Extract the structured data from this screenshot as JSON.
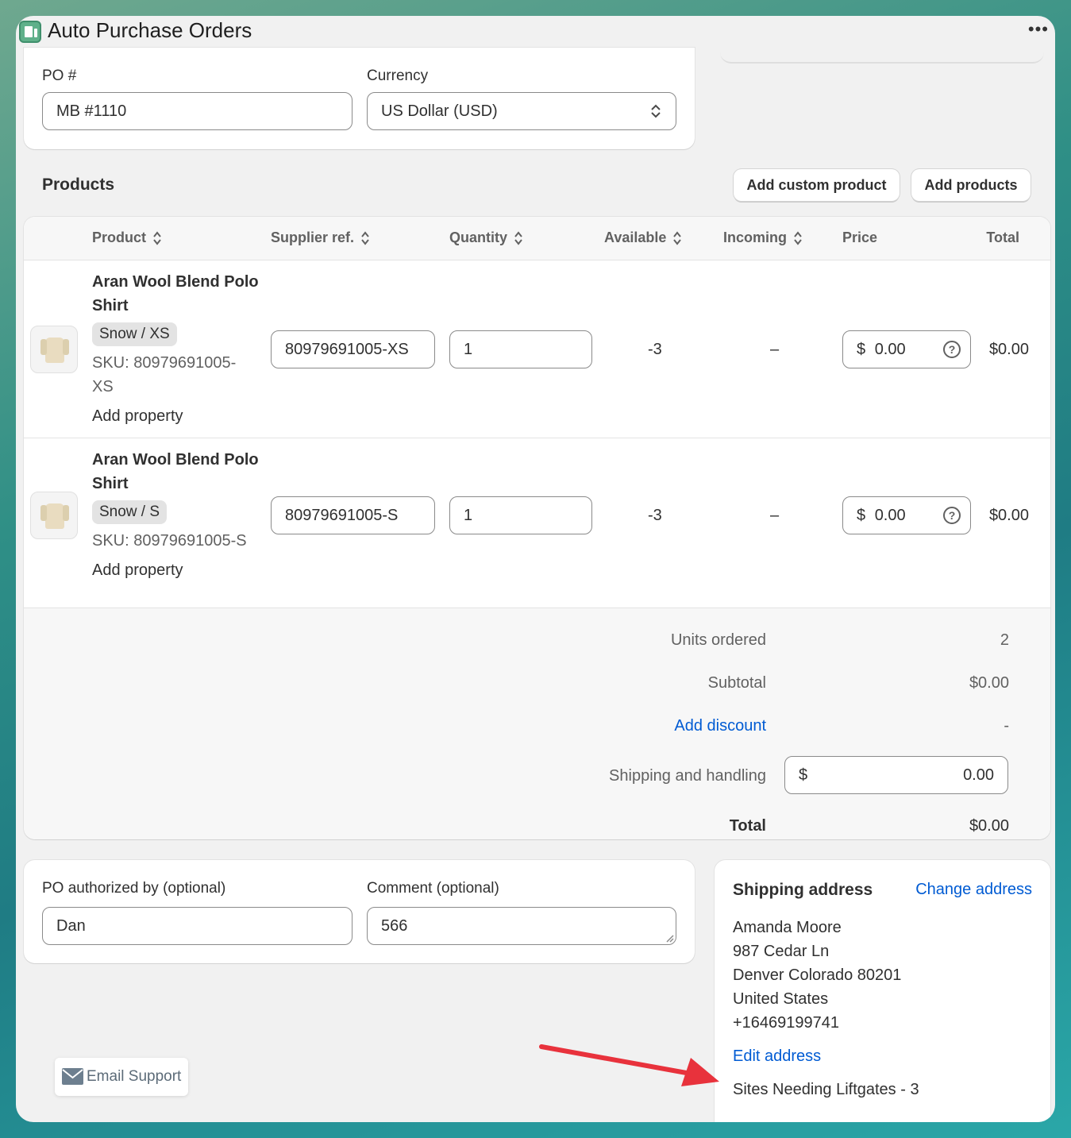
{
  "app": {
    "title": "Auto Purchase Orders",
    "more": "•••"
  },
  "po": {
    "po_label": "PO #",
    "po_value": "MB #1110",
    "currency_label": "Currency",
    "currency_value": "US Dollar (USD)"
  },
  "products": {
    "title": "Products",
    "add_custom_label": "Add custom product",
    "add_products_label": "Add products",
    "columns": {
      "product": "Product",
      "supplier_ref": "Supplier ref.",
      "quantity": "Quantity",
      "available": "Available",
      "incoming": "Incoming",
      "price": "Price",
      "total": "Total"
    },
    "rows": [
      {
        "name_line1": "Aran Wool Blend Polo",
        "name_line2": "Shirt",
        "variant": "Snow / XS",
        "sku_line1": "SKU: 80979691005-",
        "sku_line2": "XS",
        "add_property": "Add property",
        "supplier_ref": "80979691005-XS",
        "quantity": "1",
        "available": "-3",
        "incoming": "–",
        "currency_symbol": "$",
        "price": "0.00",
        "help": "?",
        "total": "$0.00"
      },
      {
        "name_line1": "Aran Wool Blend Polo",
        "name_line2": "Shirt",
        "variant": "Snow / S",
        "sku_line1": "SKU: 80979691005-S",
        "add_property": "Add property",
        "supplier_ref": "80979691005-S",
        "quantity": "1",
        "available": "-3",
        "incoming": "–",
        "currency_symbol": "$",
        "price": "0.00",
        "help": "?",
        "total": "$0.00"
      }
    ]
  },
  "summary": {
    "units_label": "Units ordered",
    "units_value": "2",
    "subtotal_label": "Subtotal",
    "subtotal_value": "$0.00",
    "discount_label": "Add discount",
    "discount_value": "-",
    "shipping_label": "Shipping and handling",
    "shipping_symbol": "$",
    "shipping_value": "0.00",
    "total_label": "Total",
    "total_value": "$0.00"
  },
  "footer_form": {
    "authorized_label": "PO authorized by (optional)",
    "authorized_value": "Dan",
    "comment_label": "Comment (optional)",
    "comment_value": "566"
  },
  "shipping": {
    "title": "Shipping address",
    "change_label": "Change address",
    "name": "Amanda Moore",
    "street": "987 Cedar Ln",
    "city": "Denver Colorado 80201",
    "country": "United States",
    "phone": "+16469199741",
    "edit_label": "Edit address",
    "note": "Sites Needing Liftgates - 3"
  },
  "support": {
    "label": "Email Support"
  },
  "colors": {
    "link": "#005bd3",
    "annotation_arrow": "#e8323c"
  }
}
